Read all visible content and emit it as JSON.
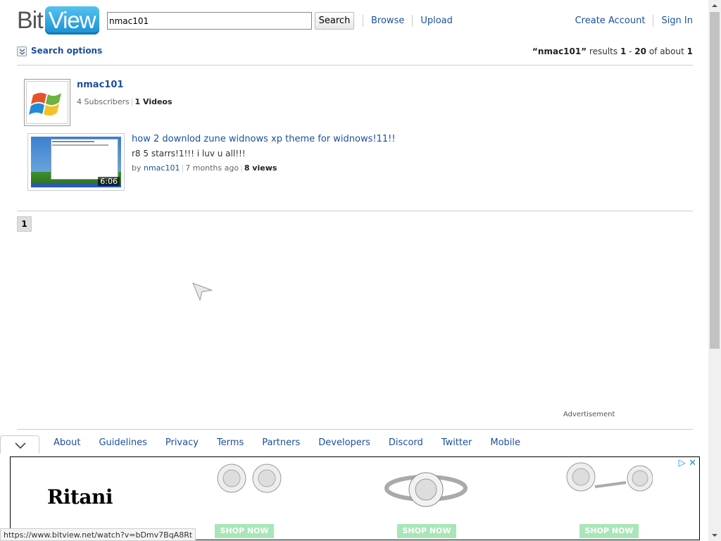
{
  "header": {
    "logo_bit": "Bit",
    "logo_view": "View",
    "search_value": "nmac101",
    "search_button": "Search",
    "nav_left": [
      "Browse",
      "Upload"
    ],
    "nav_right": [
      "Create Account",
      "Sign In"
    ]
  },
  "subheader": {
    "search_options": "Search options",
    "query": "“nmac101”",
    "results_word": " results ",
    "range_start": "1",
    "range_dash": " - ",
    "range_end": "20",
    "of_about": " of about ",
    "total": "1"
  },
  "channel": {
    "name": "nmac101",
    "subscribers": "4 Subscribers",
    "videos": "1 Videos"
  },
  "video": {
    "title": "how 2 downlod zune widnows xp theme for widnows!11!!",
    "description": "r8 5 starrs!1!!! i luv u all!!!",
    "by_label": "by ",
    "author": "nmac101",
    "age": "7 months ago",
    "views": "8 views",
    "duration": "6:06"
  },
  "pagination": {
    "current_page": "1"
  },
  "advertisement_label": "Advertisement",
  "footer": {
    "links": [
      "About",
      "Guidelines",
      "Privacy",
      "Terms",
      "Partners",
      "Developers",
      "Discord",
      "Twitter",
      "Mobile"
    ]
  },
  "ad_banner": {
    "brand": "Ritani",
    "cta": "SHOP NOW"
  },
  "status_url": "https://www.bitview.net/watch?v=bDmv7BqA8Rt",
  "colors": {
    "link": "#1c4f9c",
    "logo_blue": "#1b8fd3",
    "shop_now": "#a8e6b8"
  }
}
